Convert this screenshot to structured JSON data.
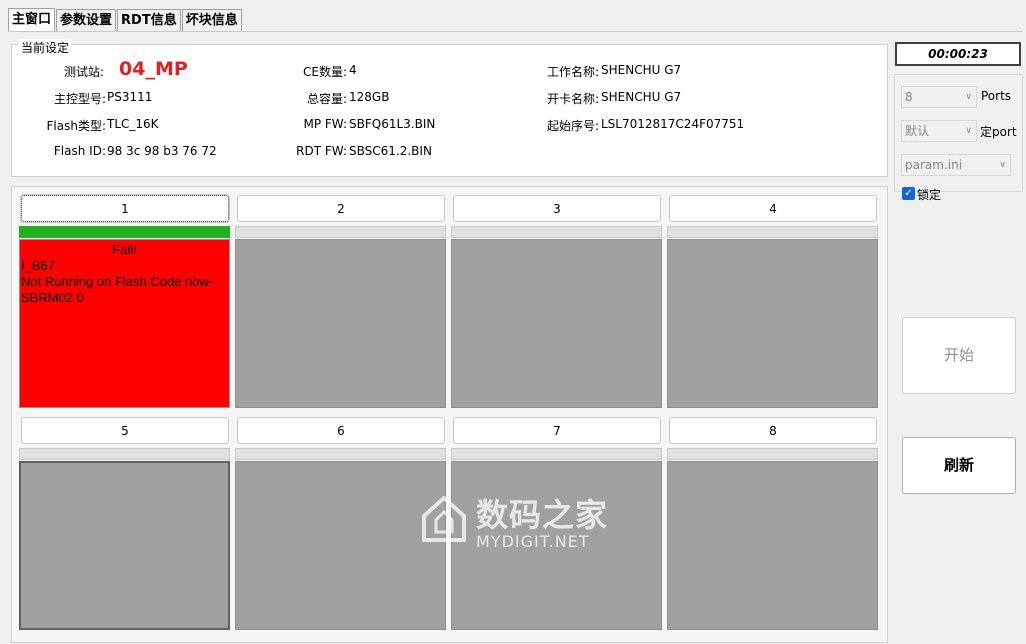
{
  "tabs": [
    "主窗口",
    "参数设置",
    "RDT信息",
    "坏块信息"
  ],
  "settings": {
    "title": "当前设定",
    "station_label": "测试站:",
    "station_value": "04_MP",
    "controller_label": "主控型号:",
    "controller_value": "PS3111",
    "flash_type_label": "Flash类型:",
    "flash_type_value": "TLC_16K",
    "flash_id_label": "Flash ID:",
    "flash_id_value": "98 3c 98 b3 76 72",
    "ce_label": "CE数量:",
    "ce_value": "4",
    "capacity_label": "总容量:",
    "capacity_value": "128GB",
    "mp_fw_label": "MP FW:",
    "mp_fw_value": "SBFQ61L3.BIN",
    "rdt_fw_label": "RDT FW:",
    "rdt_fw_value": "SBSC61.2.BIN",
    "work_name_label": "工作名称:",
    "work_name_value": "SHENCHU G7",
    "card_name_label": "开卡名称:",
    "card_name_value": "SHENCHU G7",
    "start_serial_label": "起始序号:",
    "start_serial_value": "LSL7012817C24F07751"
  },
  "ports": [
    {
      "label": "1",
      "status": "Fail!",
      "lines": [
        "I_B67",
        "Not Running on Flash Code now-",
        "SBRM02 0"
      ],
      "progress": 1.0
    },
    {
      "label": "2"
    },
    {
      "label": "3"
    },
    {
      "label": "4"
    },
    {
      "label": "5"
    },
    {
      "label": "6"
    },
    {
      "label": "7"
    },
    {
      "label": "8"
    }
  ],
  "timer": "00:00:23",
  "side": {
    "ports_select": "8",
    "ports_label": "Ports",
    "mode_select": "默认",
    "mode_label": "定port",
    "param_select": "param.ini",
    "lock_label": "锁定",
    "lock_checked": true
  },
  "buttons": {
    "start": "开始",
    "refresh": "刷新"
  },
  "watermark": {
    "cn": "数码之家",
    "en": "MYDIGIT.NET"
  },
  "colors": {
    "fail": "#ff0000",
    "progress": "#20b020",
    "idle": "#a0a0a0",
    "station": "#e02020",
    "check": "#1565d8"
  }
}
